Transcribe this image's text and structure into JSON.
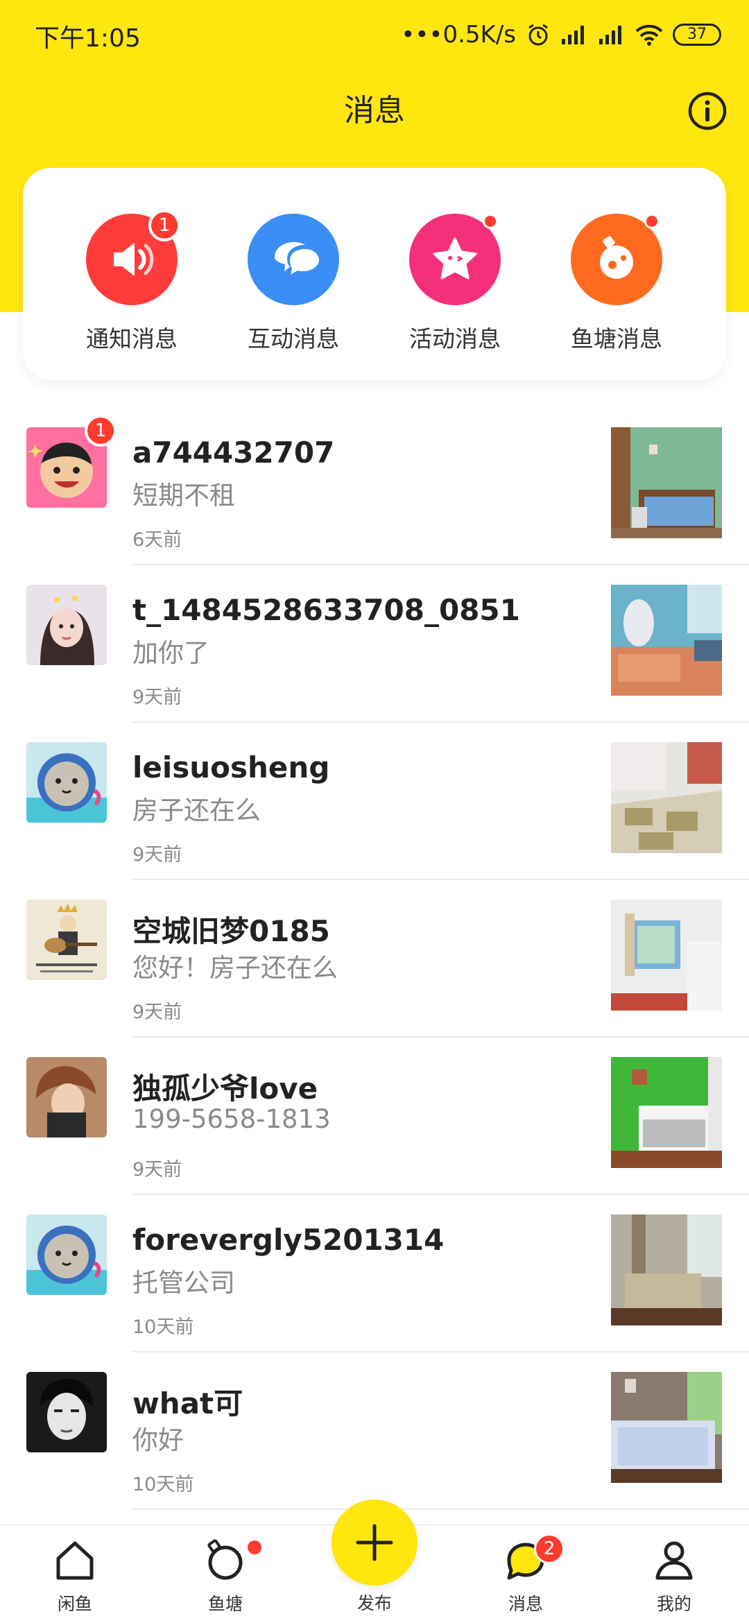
{
  "status_bar": {
    "time": "下午1:05",
    "network_speed": "•••0.5K/s",
    "battery": "37",
    "icons": [
      "alarm-icon",
      "signal-icon",
      "signal-icon",
      "wifi-icon",
      "battery-icon"
    ]
  },
  "header": {
    "title": "消息",
    "info_icon": "info-icon"
  },
  "categories": [
    {
      "label": "通知消息",
      "icon": "speaker-icon",
      "color": "#ff3b3b",
      "badge": "1"
    },
    {
      "label": "互动消息",
      "icon": "chat-bubbles-icon",
      "color": "#3a8ef5",
      "badge": ""
    },
    {
      "label": "活动消息",
      "icon": "star-icon",
      "color": "#f5307a",
      "badge": "dot"
    },
    {
      "label": "鱼塘消息",
      "icon": "pond-icon",
      "color": "#ff6a1f",
      "badge": "dot"
    }
  ],
  "conversations": [
    {
      "name": "a744432707",
      "message": "短期不租",
      "time": "6天前",
      "badge": "1"
    },
    {
      "name": "t_1484528633708_0851",
      "message": "加你了",
      "time": "9天前",
      "badge": ""
    },
    {
      "name": "leisuosheng",
      "message": "房子还在么",
      "time": "9天前",
      "badge": ""
    },
    {
      "name": "空城旧梦0185",
      "message": "您好！房子还在么",
      "time": "9天前",
      "badge": ""
    },
    {
      "name": "独孤少爷love",
      "message": "199-5658-1813",
      "time": "9天前",
      "badge": ""
    },
    {
      "name": "forevergly5201314",
      "message": "托管公司",
      "time": "10天前",
      "badge": ""
    },
    {
      "name": "what可",
      "message": "你好",
      "time": "10天前",
      "badge": ""
    }
  ],
  "tab_bar": {
    "tabs": [
      {
        "label": "闲鱼",
        "icon": "home-icon"
      },
      {
        "label": "鱼塘",
        "icon": "pond-tab-icon",
        "badge": "dot"
      },
      {
        "label": "发布",
        "icon": "plus-icon"
      },
      {
        "label": "消息",
        "icon": "message-icon",
        "badge": "2"
      },
      {
        "label": "我的",
        "icon": "profile-icon"
      }
    ]
  },
  "colors": {
    "brand_yellow": "#ffe60f",
    "badge_red": "#ff3b30"
  }
}
